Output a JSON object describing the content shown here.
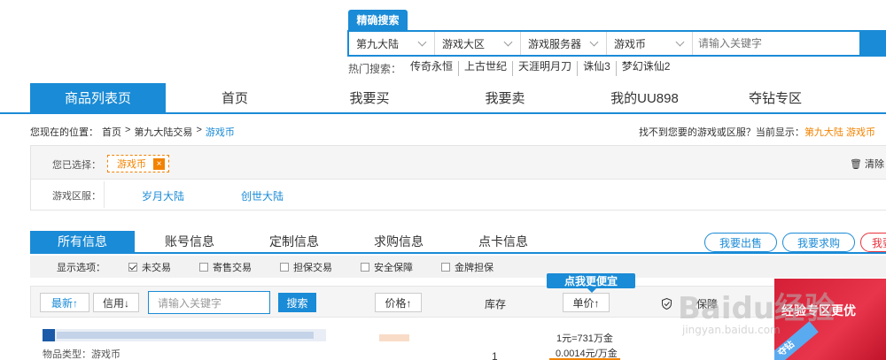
{
  "search": {
    "tab_label": "精确搜索",
    "selects": [
      "第九大陆",
      "游戏大区",
      "游戏服务器",
      "游戏币"
    ],
    "placeholder": "请输入关键字",
    "hot_label": "热门搜索：",
    "hot_items": [
      "传奇永恒",
      "上古世纪",
      "天涯明月刀",
      "诛仙3",
      "梦幻诛仙2"
    ]
  },
  "nav": {
    "items": [
      "商品列表页",
      "首页",
      "我要买",
      "我要卖",
      "我的UU898",
      "夺钻专区"
    ]
  },
  "breadcrumb": {
    "prefix": "您现在的位置：",
    "home": "首页",
    "sep": ">",
    "trade": "第九大陆交易",
    "current": "游戏币",
    "right_text": "找不到您要的游戏或区服？当前显示：",
    "right_highlight": "第九大陆 游戏币"
  },
  "filter": {
    "selected_label": "您已选择：",
    "selected_chip": "游戏币",
    "chip_close": "×",
    "clear": "清除",
    "server_label": "游戏区服：",
    "servers": [
      "岁月大陆",
      "创世大陆"
    ]
  },
  "tabs": {
    "items": [
      "所有信息",
      "账号信息",
      "定制信息",
      "求购信息",
      "点卡信息"
    ],
    "buttons": [
      "我要出售",
      "我要求购",
      "我要"
    ]
  },
  "options": {
    "label": "显示选项：",
    "items": [
      {
        "label": "未交易",
        "checked": true
      },
      {
        "label": "寄售交易",
        "checked": false
      },
      {
        "label": "担保交易",
        "checked": false
      },
      {
        "label": "安全保障",
        "checked": false
      },
      {
        "label": "金牌担保",
        "checked": false
      }
    ]
  },
  "sortbar": {
    "newest": "最新↑",
    "credit": "信用↓",
    "keyword_placeholder": "请输入关键字",
    "search": "搜索",
    "price": "价格↑",
    "stock": "库存",
    "unit_price": "单价↑",
    "security": "保障",
    "cheap_tip": "点我更便宜"
  },
  "listing": {
    "type_line": "物品类型：游戏币",
    "qty": "1",
    "unit_line1": "1元=731万金",
    "unit_line2": "0.0014元/万金"
  },
  "promo": {
    "text": "经验专区更优",
    "corner": "夺钻"
  },
  "watermark": {
    "main": "Baidu经验",
    "sub": "jingyan.baidu.com"
  }
}
